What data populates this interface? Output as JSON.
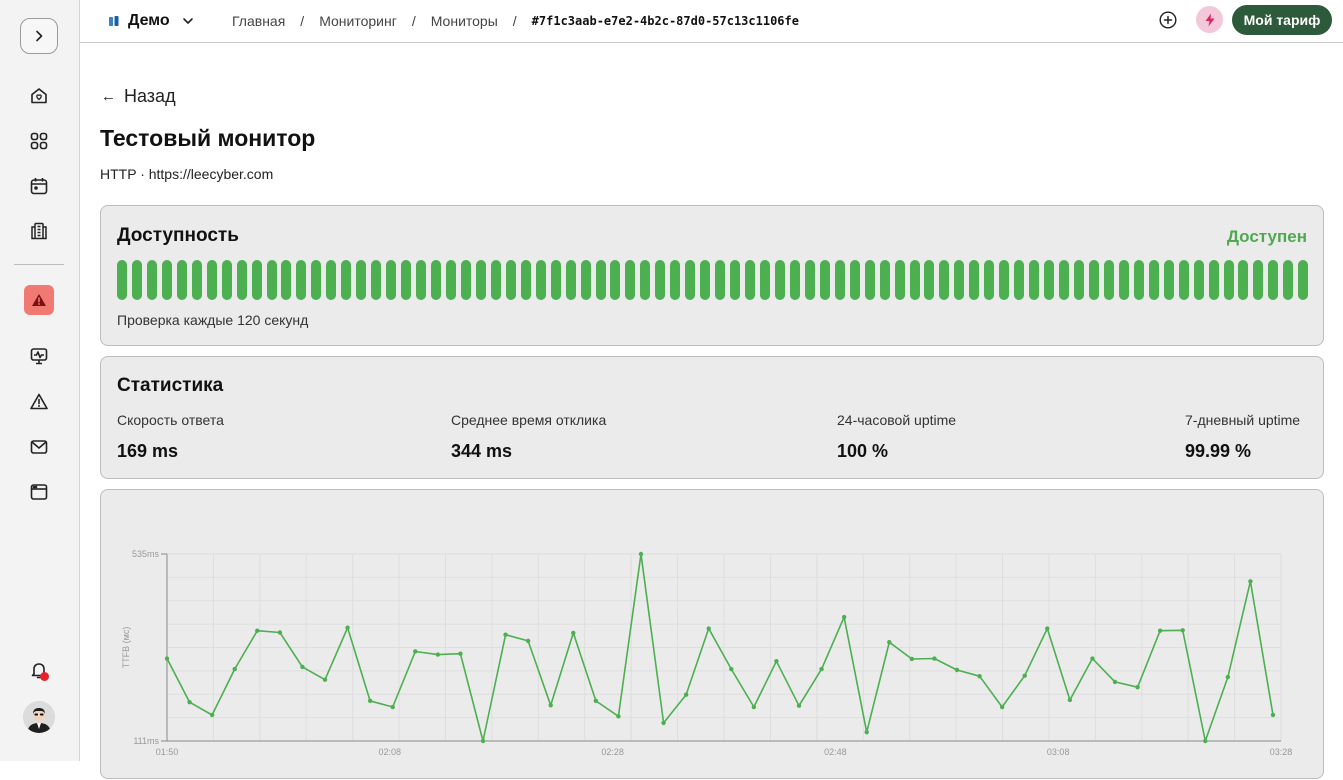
{
  "topbar": {
    "workspace": "Демо",
    "breadcrumbs": [
      "Главная",
      "Мониторинг",
      "Мониторы",
      "#7f1c3aab-e7e2-4b2c-87d0-57c13c1106fe"
    ],
    "separator": "/",
    "plan_button": "Мой тариф"
  },
  "sidebar": {
    "items": [
      "home-icon",
      "apps-grid-icon",
      "calendar-icon",
      "building-icon",
      "alert-icon",
      "monitor-icon",
      "warning-icon",
      "mail-icon",
      "browser-icon",
      "bell-icon"
    ]
  },
  "page": {
    "back": "Назад",
    "back_arrow": "←",
    "title": "Тестовый монитор",
    "subtitle": "HTTP · https://leecyber.com"
  },
  "availability": {
    "title": "Доступность",
    "status": "Доступен",
    "status_color": "#4ea94f",
    "bar_color": "#4caf50",
    "checks": [
      1,
      1,
      1,
      1,
      1,
      1,
      1,
      1,
      1,
      1,
      1,
      1,
      1,
      1,
      1,
      1,
      1,
      1,
      1,
      1,
      1,
      1,
      1,
      1,
      1,
      1,
      1,
      1,
      1,
      1,
      1,
      1,
      1,
      1,
      1,
      1,
      1,
      1,
      1,
      1,
      1,
      1,
      1,
      1,
      1,
      1,
      1,
      1,
      1,
      1,
      1,
      1,
      1,
      1,
      1,
      1,
      1,
      1,
      1,
      1,
      1,
      1,
      1,
      1,
      1,
      1,
      1,
      1,
      1,
      1,
      1,
      1,
      1,
      1,
      1,
      1,
      1,
      1,
      1,
      1
    ],
    "interval_text": "Проверка каждые 120 секунд"
  },
  "statistics": {
    "title": "Статистика",
    "items": [
      {
        "label": "Скорость ответа",
        "value": "169 ms"
      },
      {
        "label": "Среднее время отклика",
        "value": "344 ms"
      },
      {
        "label": "24-часовой uptime",
        "value": "100 %"
      },
      {
        "label": "7-дневный uptime",
        "value": "99.99 %"
      }
    ]
  },
  "chart_data": {
    "type": "line",
    "ylabel": "TTFB (мс)",
    "ylim": [
      111,
      535
    ],
    "ytick_labels": [
      "535ms",
      "111ms"
    ],
    "xtick_labels": [
      "01:50",
      "02:08",
      "02:28",
      "02:48",
      "03:08",
      "03:28"
    ],
    "grid": true,
    "line_color": "#4caf50",
    "series": [
      {
        "values": [
          298,
          199,
          170,
          274,
          361,
          357,
          279,
          250,
          368,
          202,
          188,
          314,
          307,
          309,
          111,
          352,
          338,
          192,
          356,
          202,
          167,
          535,
          152,
          216,
          366,
          274,
          188,
          292,
          191,
          274,
          392,
          131,
          335,
          297,
          298,
          272,
          258,
          188,
          259,
          366,
          204,
          298,
          245,
          233,
          361,
          362,
          111,
          256,
          473,
          170
        ]
      }
    ]
  }
}
